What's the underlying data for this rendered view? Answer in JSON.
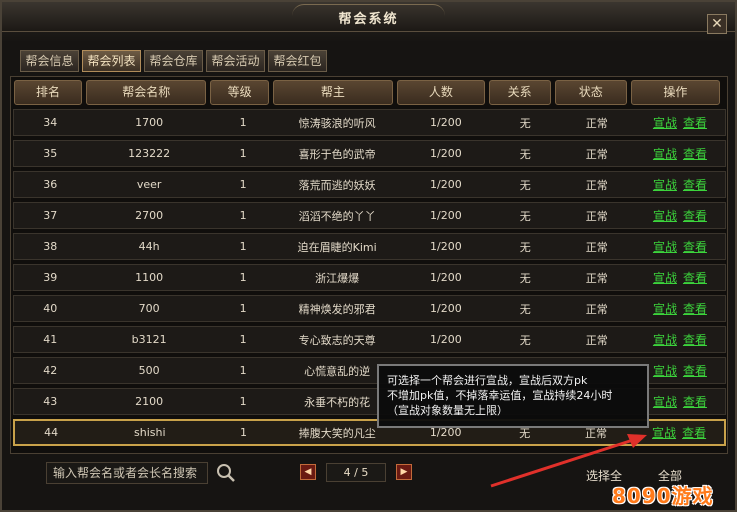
{
  "window": {
    "title": "帮会系统",
    "close_label": "✕"
  },
  "tabs": [
    {
      "label": "帮会信息"
    },
    {
      "label": "帮会列表",
      "active": true
    },
    {
      "label": "帮会仓库"
    },
    {
      "label": "帮会活动"
    },
    {
      "label": "帮会红包"
    }
  ],
  "columns": [
    {
      "label": "排名"
    },
    {
      "label": "帮会名称"
    },
    {
      "label": "等级"
    },
    {
      "label": "帮主"
    },
    {
      "label": "人数"
    },
    {
      "label": "关系"
    },
    {
      "label": "状态"
    },
    {
      "label": "操作"
    }
  ],
  "action_labels": {
    "declare": "宣战",
    "view": "查看"
  },
  "rows": [
    {
      "rank": "34",
      "name": "1700",
      "level": "1",
      "leader": "惊涛骇浪的听风",
      "members": "1/200",
      "relation": "无",
      "status": "正常"
    },
    {
      "rank": "35",
      "name": "123222",
      "level": "1",
      "leader": "喜形于色的武帝",
      "members": "1/200",
      "relation": "无",
      "status": "正常"
    },
    {
      "rank": "36",
      "name": "veer",
      "level": "1",
      "leader": "落荒而逃的妖妖",
      "members": "1/200",
      "relation": "无",
      "status": "正常"
    },
    {
      "rank": "37",
      "name": "2700",
      "level": "1",
      "leader": "滔滔不绝的丫丫",
      "members": "1/200",
      "relation": "无",
      "status": "正常"
    },
    {
      "rank": "38",
      "name": "44h",
      "level": "1",
      "leader": "迫在眉睫的Kimi",
      "members": "1/200",
      "relation": "无",
      "status": "正常"
    },
    {
      "rank": "39",
      "name": "1100",
      "level": "1",
      "leader": "浙江爆爆",
      "members": "1/200",
      "relation": "无",
      "status": "正常"
    },
    {
      "rank": "40",
      "name": "700",
      "level": "1",
      "leader": "精神焕发的邪君",
      "members": "1/200",
      "relation": "无",
      "status": "正常"
    },
    {
      "rank": "41",
      "name": "b3121",
      "level": "1",
      "leader": "专心致志的天尊",
      "members": "1/200",
      "relation": "无",
      "status": "正常"
    },
    {
      "rank": "42",
      "name": "500",
      "level": "1",
      "leader": "心慌意乱的逆",
      "members": "",
      "relation": "",
      "status": ""
    },
    {
      "rank": "43",
      "name": "2100",
      "level": "1",
      "leader": "永垂不朽的花",
      "members": "",
      "relation": "",
      "status": ""
    },
    {
      "rank": "44",
      "name": "shishi",
      "level": "1",
      "leader": "捧腹大笑的凡尘",
      "members": "1/200",
      "relation": "无",
      "status": "正常",
      "selected": true
    }
  ],
  "tooltip": {
    "lines": [
      "可选择一个帮会进行宣战，宣战后双方pk",
      "不增加pk值，不掉落幸运值，宣战持续24小时",
      "（宣战对象数量无上限）"
    ]
  },
  "bottom": {
    "search_placeholder": "输入帮会名或者会长名搜索",
    "prev_label": "◀",
    "next_label": "▶",
    "page_text": "4 / 5",
    "select_label": "选择全",
    "all_label": "全部"
  },
  "watermark": {
    "text": "8090游戏"
  },
  "colors": {
    "accent_gold": "#c9a24a",
    "action_green": "#3cd43c",
    "arrow_red": "#e0302a"
  }
}
